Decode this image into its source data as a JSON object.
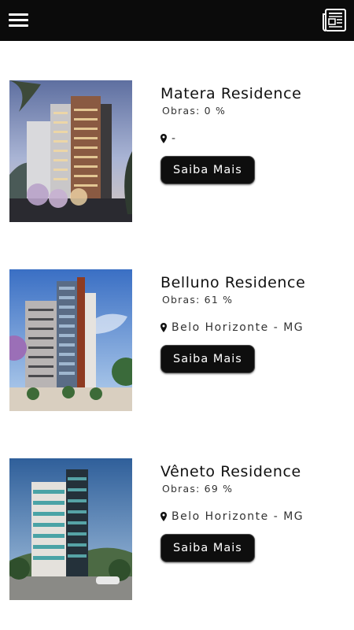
{
  "header": {
    "menu_icon": "hamburger-menu-icon",
    "news_icon": "newspaper-icon"
  },
  "listings": [
    {
      "title": "Matera Residence",
      "progress": "Obras: 0 %",
      "location": "-",
      "button_label": "Saiba Mais"
    },
    {
      "title": "Belluno Residence",
      "progress": "Obras: 61 %",
      "location": "Belo Horizonte - MG",
      "button_label": "Saiba Mais"
    },
    {
      "title": "Vêneto Residence",
      "progress": "Obras: 69 %",
      "location": "Belo Horizonte - MG",
      "button_label": "Saiba Mais"
    }
  ],
  "colors": {
    "header_bg": "#0b0b0b",
    "button_bg": "#0e0e0e",
    "page_bg": "#ffffff"
  }
}
